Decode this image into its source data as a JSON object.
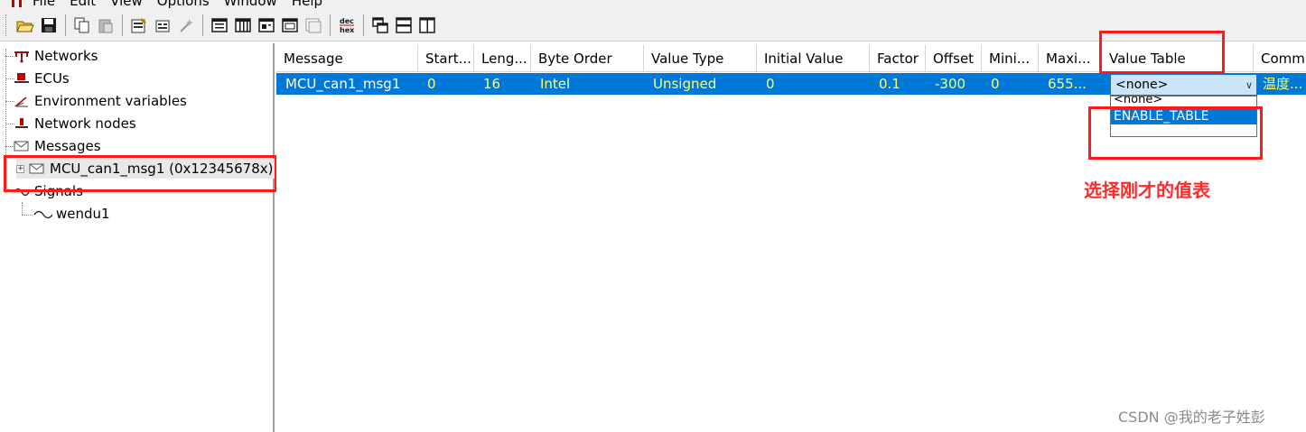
{
  "menubar": {
    "items": [
      "File",
      "Edit",
      "View",
      "Options",
      "Window",
      "Help"
    ]
  },
  "toolbar": {
    "buttons": [
      {
        "icon": "open-folder-icon"
      },
      {
        "icon": "save-icon"
      },
      {
        "icon": "copy-icon"
      },
      {
        "icon": "paste-icon"
      },
      {
        "icon": "properties-icon"
      },
      {
        "icon": "edit-icon"
      },
      {
        "icon": "wizard-icon"
      },
      {
        "icon": "view1-icon"
      },
      {
        "icon": "view2-icon"
      },
      {
        "icon": "view3-icon"
      },
      {
        "icon": "view4-icon"
      },
      {
        "icon": "view5-icon"
      },
      {
        "icon": "dec-hex-icon",
        "text": "dec\nhex"
      },
      {
        "icon": "cascade-icon"
      },
      {
        "icon": "tile-horizontal-icon"
      },
      {
        "icon": "tile-vertical-icon"
      }
    ]
  },
  "tree": {
    "networks": "Networks",
    "ecus": "ECUs",
    "env_vars": "Environment variables",
    "network_nodes": "Network nodes",
    "messages": "Messages",
    "message_child": "MCU_can1_msg1 (0x12345678x)",
    "signals": "Signals",
    "signal_child": "wendu1"
  },
  "table": {
    "headers": [
      "Message",
      "Start...",
      "Leng...",
      "Byte Order",
      "Value Type",
      "Initial Value",
      "Factor",
      "Offset",
      "Mini...",
      "Maxi...",
      "Value Table",
      "Comm"
    ],
    "row": [
      "MCU_can1_msg1",
      "0",
      "16",
      "Intel",
      "Unsigned",
      "0",
      "0.1",
      "-300",
      "0",
      "655...",
      "<none>",
      "温度..."
    ]
  },
  "combo": {
    "value": "<none>",
    "options": [
      "<none>",
      "ENABLE_TABLE"
    ]
  },
  "annotation": "选择刚才的值表",
  "watermark": "CSDN @我的老子姓彭",
  "colors": {
    "highlight": "#0078d7",
    "row_text": "#ffff66",
    "annotation": "#ff2a2a"
  }
}
